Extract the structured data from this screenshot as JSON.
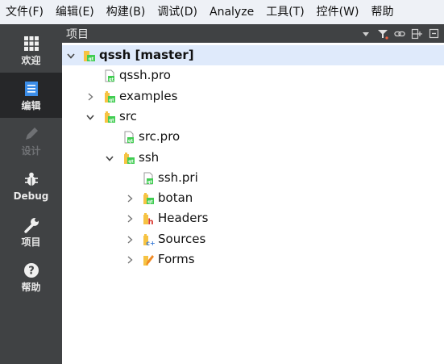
{
  "menubar": {
    "items": [
      "文件(F)",
      "编辑(E)",
      "构建(B)",
      "调试(D)",
      "Analyze",
      "工具(T)",
      "控件(W)",
      "帮助"
    ]
  },
  "modes": [
    {
      "id": "welcome",
      "label": "欢迎",
      "icon": "grid-icon",
      "state": "normal"
    },
    {
      "id": "edit",
      "label": "编辑",
      "icon": "document-icon",
      "state": "active"
    },
    {
      "id": "design",
      "label": "设计",
      "icon": "pencil-icon",
      "state": "disabled"
    },
    {
      "id": "debug",
      "label": "Debug",
      "icon": "bug-icon",
      "state": "normal"
    },
    {
      "id": "projects",
      "label": "项目",
      "icon": "wrench-icon",
      "state": "normal"
    },
    {
      "id": "help",
      "label": "帮助",
      "icon": "question-icon",
      "state": "normal"
    }
  ],
  "pane": {
    "title": "项目",
    "tools": [
      "dropdown-icon",
      "filter-icon",
      "link-icon",
      "split-icon",
      "close-icon"
    ]
  },
  "tree": {
    "rows": [
      {
        "label": "qssh [master]",
        "depth": 0,
        "arrow": "expanded",
        "icon": "project-icon",
        "selected": true
      },
      {
        "label": "qssh.pro",
        "depth": 1,
        "arrow": "none",
        "icon": "pro-file-icon",
        "selected": false
      },
      {
        "label": "examples",
        "depth": 1,
        "arrow": "collapsed",
        "icon": "folder-icon",
        "selected": false
      },
      {
        "label": "src",
        "depth": 1,
        "arrow": "expanded",
        "icon": "folder-icon",
        "selected": false
      },
      {
        "label": "src.pro",
        "depth": 2,
        "arrow": "none",
        "icon": "pro-file-icon",
        "selected": false
      },
      {
        "label": "ssh",
        "depth": 2,
        "arrow": "expanded",
        "icon": "folder-icon",
        "selected": false
      },
      {
        "label": "ssh.pri",
        "depth": 3,
        "arrow": "none",
        "icon": "pro-file-icon",
        "selected": false
      },
      {
        "label": "botan",
        "depth": 3,
        "arrow": "collapsed",
        "icon": "folder-icon",
        "selected": false
      },
      {
        "label": "Headers",
        "depth": 3,
        "arrow": "collapsed",
        "icon": "headers-folder-icon",
        "selected": false
      },
      {
        "label": "Sources",
        "depth": 3,
        "arrow": "collapsed",
        "icon": "sources-folder-icon",
        "selected": false
      },
      {
        "label": "Forms",
        "depth": 3,
        "arrow": "collapsed",
        "icon": "forms-folder-icon",
        "selected": false
      }
    ]
  },
  "colors": {
    "modebar_bg": "#404244",
    "mode_active_bg": "#262729",
    "selection_bg": "#dfeafb",
    "qt_green": "#41cd52",
    "folder_yellow": "#f6c343",
    "headers_red": "#d9342b",
    "sources_blue": "#3b7dd8"
  }
}
